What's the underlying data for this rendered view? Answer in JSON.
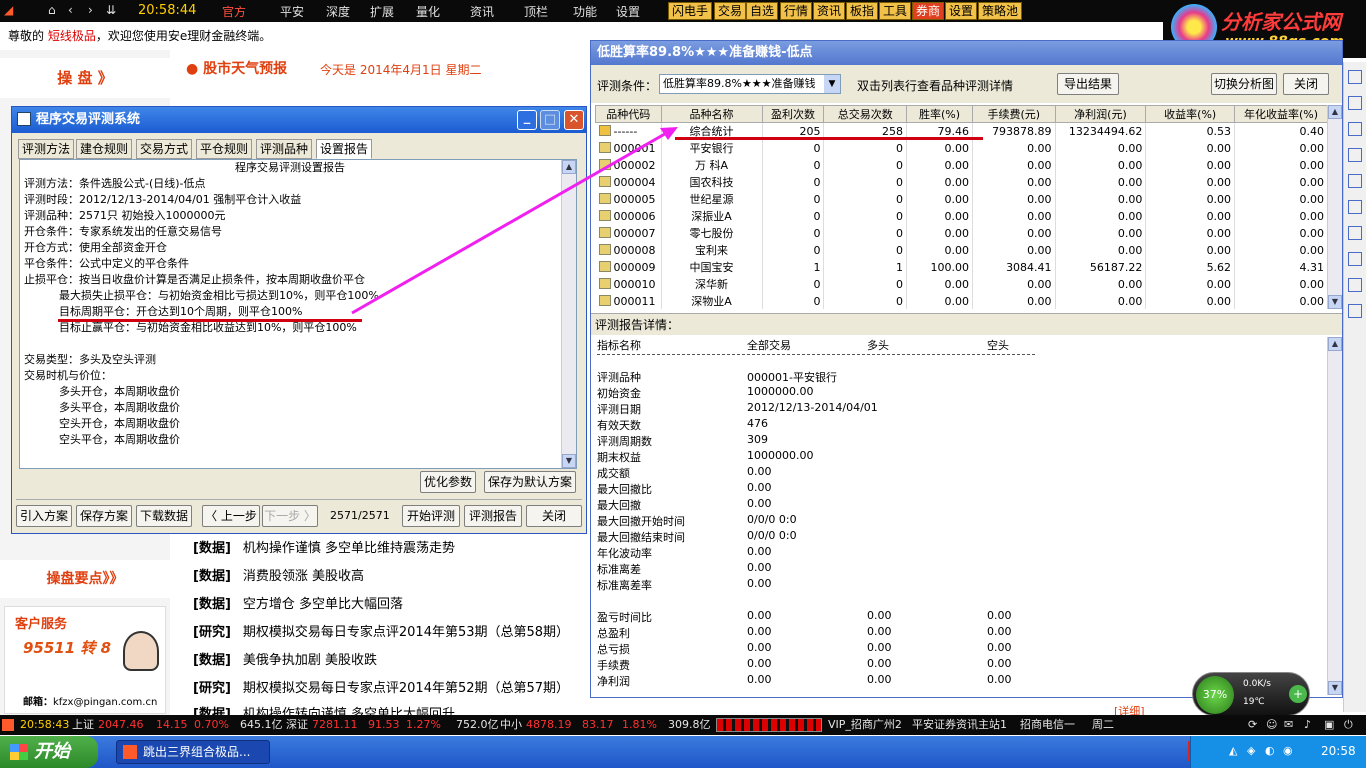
{
  "topbar": {
    "time": "20:58:44",
    "menu": [
      "官方",
      "平安",
      "深度",
      "扩展",
      "量化",
      "资讯",
      "顶栏",
      "功能",
      "设置"
    ],
    "buttons": [
      "闪电手",
      "交易",
      "自选",
      "行情",
      "资讯",
      "板指",
      "工具",
      "券商",
      "设置",
      "策略池"
    ],
    "brand_title": "分析家公式网",
    "brand_url": "www.88gs.com"
  },
  "welcome": {
    "prefix": "尊敬的",
    "user": "短线极品",
    "suffix": "，欢迎您使用安e理财金融终端。"
  },
  "left": {
    "panel1": "操 盘 》",
    "panel2": "操盘要点》》",
    "service_title": "客户服务",
    "service_phone": "95511 转 8",
    "mail_label": "邮箱：",
    "mail": "kfzx@pingan.com.cn"
  },
  "center": {
    "weather_title": "股市天气预报",
    "date_text": "今天是 2014年4月1日 星期二",
    "news": [
      {
        "tag": "[数据]",
        "text": "机构操作谨慎 多空单比维持震荡走势"
      },
      {
        "tag": "[数据]",
        "text": "消费股领涨 美股收高"
      },
      {
        "tag": "[数据]",
        "text": "空方增仓 多空单比大幅回落"
      },
      {
        "tag": "[研究]",
        "text": "期权模拟交易每日专家点评2014年第53期（总第58期）"
      },
      {
        "tag": "[数据]",
        "text": "美俄争执加剧 美股收跌"
      },
      {
        "tag": "[研究]",
        "text": "期权模拟交易每日专家点评2014年第52期（总第57期）"
      },
      {
        "tag": "[数据]",
        "text": "机构操作转向谨慎 多空单比大幅回升"
      }
    ],
    "detail_link": "[详细]"
  },
  "leftwin": {
    "title": "程序交易评测系统",
    "tabs": [
      "评测方法",
      "建仓规则",
      "交易方式",
      "平仓规则",
      "评测品种",
      "设置报告"
    ],
    "report_title": "程序交易评测设置报告",
    "lines": [
      "评测方法：条件选股公式-(日线)-低点",
      "评测时段：2012/12/13-2014/04/01 强制平仓计入收益",
      "评测品种：2571只 初始投入1000000元",
      "开仓条件：专家系统发出的任意交易信号",
      "开仓方式：使用全部资金开仓",
      "平仓条件：公式中定义的平仓条件",
      "止损平仓：按当日收盘价计算是否满足止损条件，按本周期收盘价平仓",
      "          最大损失止损平仓：与初始资金相比亏损达到10%，则平仓100%",
      "          目标周期平仓：开仓达到10个周期，则平仓100%",
      "          目标止赢平仓：与初始资金相比收益达到10%，则平仓100%",
      "",
      "交易类型：多头及空头评测",
      "交易时机与价位：",
      "          多头开仓，本周期收盘价",
      "          多头平仓，本周期收盘价",
      "          空头开仓，本周期收盘价",
      "          空头平仓，本周期收盘价"
    ],
    "btn_optimize": "优化参数",
    "btn_save_default": "保存为默认方案",
    "btn_import": "引入方案",
    "btn_save": "保存方案",
    "btn_download": "下载数据",
    "btn_prev": "〈 上一步",
    "btn_next": "下一步 〉",
    "progress": "2571/2571",
    "btn_start": "开始评测",
    "btn_report": "评测报告",
    "btn_close": "关闭"
  },
  "rightwin": {
    "title": "低胜算率89.8%★★★准备赚钱-低点",
    "cond_label": "评测条件：",
    "cond_value": "低胜算率89.8%★★★准备赚钱",
    "hint": "双击列表行查看品种评测详情",
    "btn_export": "导出结果",
    "btn_switch": "切换分析图",
    "btn_close": "关闭",
    "columns": [
      "品种代码",
      "品种名称",
      "盈利次数",
      "总交易次数",
      "胜率(%)",
      "手续费(元)",
      "净利润(元)",
      "收益率(%)",
      "年化收益率(%)"
    ],
    "rows": [
      [
        "------",
        "综合统计",
        "205",
        "258",
        "79.46",
        "793878.89",
        "13234494.62",
        "0.53",
        "0.40"
      ],
      [
        "000001",
        "平安银行",
        "0",
        "0",
        "0.00",
        "0.00",
        "0.00",
        "0.00",
        "0.00"
      ],
      [
        "000002",
        "万  科A",
        "0",
        "0",
        "0.00",
        "0.00",
        "0.00",
        "0.00",
        "0.00"
      ],
      [
        "000004",
        "国农科技",
        "0",
        "0",
        "0.00",
        "0.00",
        "0.00",
        "0.00",
        "0.00"
      ],
      [
        "000005",
        "世纪星源",
        "0",
        "0",
        "0.00",
        "0.00",
        "0.00",
        "0.00",
        "0.00"
      ],
      [
        "000006",
        "深振业A",
        "0",
        "0",
        "0.00",
        "0.00",
        "0.00",
        "0.00",
        "0.00"
      ],
      [
        "000007",
        "零七股份",
        "0",
        "0",
        "0.00",
        "0.00",
        "0.00",
        "0.00",
        "0.00"
      ],
      [
        "000008",
        "宝利来",
        "0",
        "0",
        "0.00",
        "0.00",
        "0.00",
        "0.00",
        "0.00"
      ],
      [
        "000009",
        "中国宝安",
        "1",
        "1",
        "100.00",
        "3084.41",
        "56187.22",
        "5.62",
        "4.31"
      ],
      [
        "000010",
        "深华新",
        "0",
        "0",
        "0.00",
        "0.00",
        "0.00",
        "0.00",
        "0.00"
      ],
      [
        "000011",
        "深物业A",
        "0",
        "0",
        "0.00",
        "0.00",
        "0.00",
        "0.00",
        "0.00"
      ]
    ],
    "detail_title": "评测报告详情：",
    "detail_head": [
      "指标名称",
      "全部交易",
      "多头",
      "空头"
    ],
    "detail_rows1": [
      [
        "评测品种",
        "000001-平安银行"
      ],
      [
        "初始资金",
        "1000000.00"
      ],
      [
        "评测日期",
        "2012/12/13-2014/04/01"
      ],
      [
        "有效天数",
        "476"
      ],
      [
        "评测周期数",
        "309"
      ],
      [
        "期末权益",
        "1000000.00"
      ],
      [
        "成交额",
        "0.00"
      ],
      [
        "最大回撤比",
        "0.00"
      ],
      [
        "最大回撤",
        "0.00"
      ],
      [
        "最大回撤开始时间",
        "0/0/0 0:0"
      ],
      [
        "最大回撤结束时间",
        "0/0/0 0:0"
      ],
      [
        "年化波动率",
        "0.00"
      ],
      [
        "标准离差",
        "0.00"
      ],
      [
        "标准离差率",
        "0.00"
      ]
    ],
    "detail_rows2": [
      [
        "盈亏时间比",
        "0.00",
        "0.00",
        "0.00"
      ],
      [
        "总盈利",
        "0.00",
        "0.00",
        "0.00"
      ],
      [
        "总亏损",
        "0.00",
        "0.00",
        "0.00"
      ],
      [
        "手续费",
        "0.00",
        "0.00",
        "0.00"
      ],
      [
        "净利润",
        "0.00",
        "0.00",
        "0.00"
      ]
    ]
  },
  "statusbar": {
    "time": "20:58:43",
    "sh_label": "上证",
    "sh_value": "2047.46",
    "sh_change": "14.15",
    "sh_pct": "0.70%",
    "sh_amount": "645.1亿",
    "sz_label": "深证",
    "sz_value": "7281.11",
    "sz_change": "91.53",
    "sz_pct": "1.27%",
    "sz_amount": "752.0亿",
    "zx_label": "中小",
    "zx_value": "4878.19",
    "zx_change": "83.17",
    "zx_pct": "1.81%",
    "zx_amount": "309.8亿",
    "server": "VIP_招商广州2",
    "info": "平安证券资讯主站1",
    "telecom": "招商电信一",
    "weekday": "周二"
  },
  "widget": {
    "cpu": "37%",
    "net": "0.0K/s",
    "temp": "19℃"
  },
  "taskbar": {
    "start": "开始",
    "task": "跳出三界组合极品...",
    "clock": "20:58"
  }
}
